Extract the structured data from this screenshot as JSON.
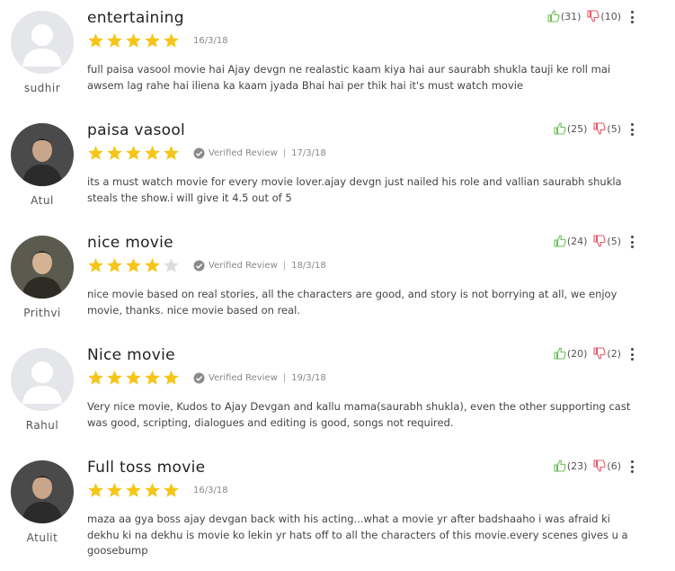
{
  "reviews": [
    {
      "user": "sudhir",
      "avatar": "default-avatar",
      "title": "entertaining",
      "rating": 5,
      "verified": false,
      "verified_label": "",
      "date": "16/3/18",
      "text": "full paisa vasool movie hai Ajay devgn ne realastic kaam kiya hai aur saurabh shukla tauji ke roll mai awsem lag rahe hai iliena ka kaam jyada Bhai hai per thik hai it's must watch movie",
      "likes": "(31)",
      "dislikes": "(10)"
    },
    {
      "user": "Atul",
      "avatar": "photo-avatar",
      "title": "paisa vasool",
      "rating": 5,
      "verified": true,
      "verified_label": "Verified Review",
      "date": "17/3/18",
      "text": "its a must watch movie for every movie lover.ajay devgn just nailed his role and vallian saurabh shukla steals the show.i will give it 4.5 out of 5",
      "likes": "(25)",
      "dislikes": "(5)"
    },
    {
      "user": "Prithvi",
      "avatar": "photo-avatar",
      "title": "nice movie",
      "rating": 4,
      "verified": true,
      "verified_label": "Verified Review",
      "date": "18/3/18",
      "text": "nice movie based on real stories, all the characters are good, and story is not borrying at all, we enjoy movie, thanks. nice movie based on real.",
      "likes": "(24)",
      "dislikes": "(5)"
    },
    {
      "user": "Rahul",
      "avatar": "default-avatar",
      "title": "Nice movie",
      "rating": 5,
      "verified": true,
      "verified_label": "Verified Review",
      "date": "19/3/18",
      "text": "Very nice movie, Kudos to Ajay Devgan and kallu mama(saurabh shukla), even the other supporting cast was good, scripting, dialogues and editing is good, songs not required.",
      "likes": "(20)",
      "dislikes": "(2)"
    },
    {
      "user": "Atulit",
      "avatar": "photo-avatar",
      "title": "Full toss movie",
      "rating": 5,
      "verified": false,
      "verified_label": "",
      "date": "16/3/18",
      "text": "maza aa gya boss ajay devgan back with his acting...what a movie yr after badshaaho i was afraid ki dekhu ki na dekhu is movie ko lekin yr hats off to all the characters of this movie.every scenes gives u a goosebump",
      "likes": "(23)",
      "dislikes": "(6)"
    }
  ],
  "colors": {
    "star_on": "#f5c518",
    "star_off": "#dddddd",
    "like": "#6cbf5a",
    "dislike": "#e05a6a"
  },
  "icons": {
    "like": "thumbs-up-icon",
    "dislike": "thumbs-down-icon",
    "more": "more-vertical-icon",
    "verified": "check-circle-icon",
    "star": "star-icon"
  }
}
